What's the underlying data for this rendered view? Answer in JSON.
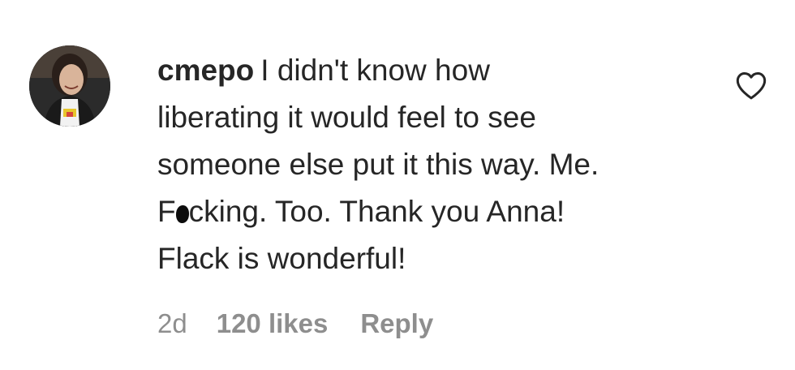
{
  "comment": {
    "username": "cmepo",
    "text_lines": [
      "I didn't know how",
      "liberating it would feel to see",
      "someone else put it this way. Me.",
      [
        "F",
        "cking. Too. Thank you Anna!"
      ],
      "Flack is wonderful!"
    ],
    "line1": "I didn't know how",
    "line2": "liberating it would feel to see",
    "line3": "someone else put it this way. Me.",
    "line4_prefix": "F",
    "line4_suffix": "cking. Too. Thank you Anna!",
    "line5": "Flack is wonderful!"
  },
  "meta": {
    "time": "2d",
    "likes": "120 likes",
    "reply": "Reply"
  },
  "icons": {
    "like": "heart-outline-icon",
    "avatar": "user-avatar"
  },
  "colors": {
    "text": "#262626",
    "secondary": "#8e8e8e",
    "background": "#ffffff"
  }
}
